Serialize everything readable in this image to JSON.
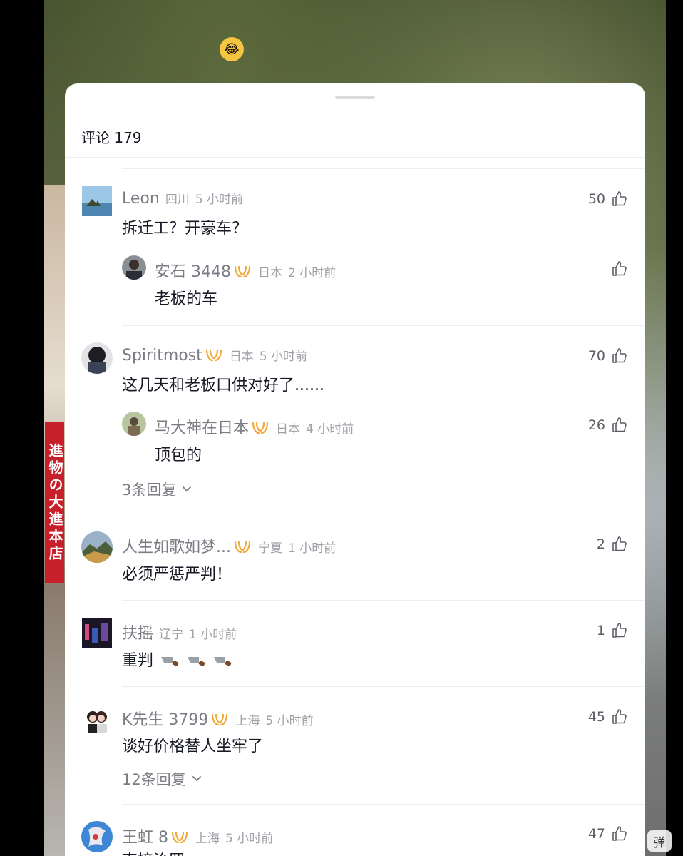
{
  "video": {
    "sign_text": "進物の大進本店",
    "danmaku_label": "弹"
  },
  "sheet": {
    "title": "评论 179"
  },
  "comments": [
    {
      "name": "Leon",
      "location": "四川",
      "time": "5 小时前",
      "text": "拆迁工？开豪车？",
      "likes": "50",
      "reply": {
        "name": "安石 3448",
        "location": "日本",
        "time": "2 小时前",
        "text": "老板的车",
        "likes": ""
      }
    },
    {
      "name": "Spiritmost",
      "location": "日本",
      "time": "5 小时前",
      "text": "这几天和老板口供对好了......",
      "likes": "70",
      "reply": {
        "name": "马大神在日本",
        "location": "日本",
        "time": "4 小时前",
        "text": "顶包的",
        "likes": "26"
      },
      "more": "3条回复"
    },
    {
      "name": "人生如歌如梦...",
      "location": "宁夏",
      "time": "1 小时前",
      "text": "必须严惩严判！",
      "likes": "2"
    },
    {
      "name": "扶摇",
      "location": "辽宁",
      "time": "1 小时前",
      "text": "重判",
      "likes": "1"
    },
    {
      "name": "K先生 3799",
      "location": "上海",
      "time": "5 小时前",
      "text": "谈好价格替人坐牢了",
      "likes": "45",
      "more": "12条回复"
    },
    {
      "name": "王虹 8",
      "location": "上海",
      "time": "5 小时前",
      "text": "直接治罪",
      "likes": "47"
    }
  ],
  "colors": {
    "badge": "#f2a93b",
    "name": "#7a7c83",
    "text": "#161823"
  }
}
